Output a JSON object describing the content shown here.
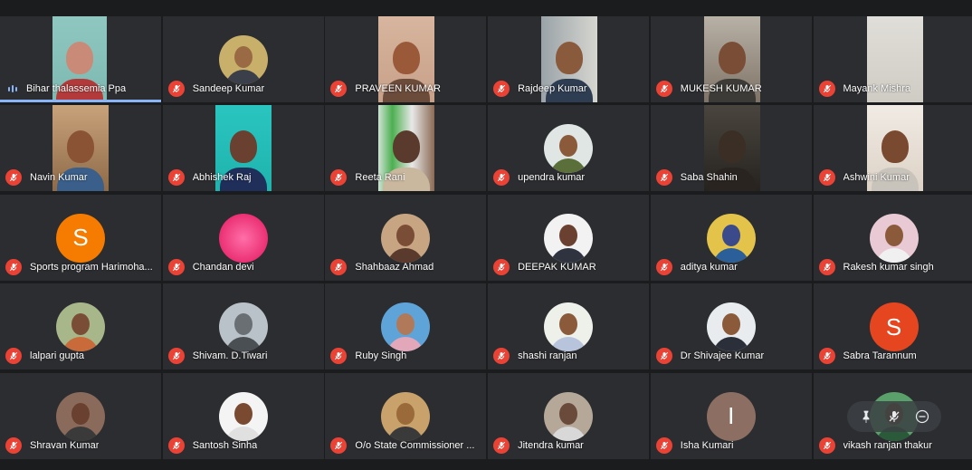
{
  "meeting": {
    "participants": [
      {
        "name": "Bihar thalassemia Ppa",
        "kind": "video",
        "muted": false,
        "speaking": true,
        "photo": "woman-glasses"
      },
      {
        "name": "Sandeep Kumar",
        "kind": "avatar",
        "muted": true,
        "photo": "man-sunglasses"
      },
      {
        "name": "PRAVEEN KUMAR",
        "kind": "video",
        "muted": true,
        "photo": "man-indoor"
      },
      {
        "name": "Rajdeep Kumar",
        "kind": "video",
        "muted": true,
        "photo": "man-window"
      },
      {
        "name": "MUKESH KUMAR",
        "kind": "video",
        "muted": true,
        "photo": "man-roof"
      },
      {
        "name": "Mayank Mishra",
        "kind": "video",
        "muted": true,
        "photo": "wall"
      },
      {
        "name": "Navin Kumar",
        "kind": "video",
        "muted": true,
        "photo": "man-wood"
      },
      {
        "name": "Abhishek Raj",
        "kind": "video",
        "muted": true,
        "photo": "boy-teal"
      },
      {
        "name": "Reeta Rani",
        "kind": "video",
        "muted": true,
        "photo": "flag"
      },
      {
        "name": "upendra kumar",
        "kind": "avatar",
        "muted": true,
        "photo": "man-outdoor"
      },
      {
        "name": "Saba Shahin",
        "kind": "video",
        "muted": true,
        "photo": "dark"
      },
      {
        "name": "Ashwini Kumar",
        "kind": "video",
        "muted": true,
        "photo": "man-bright"
      },
      {
        "name": "Sports program Harimoha...",
        "kind": "letter",
        "letter": "S",
        "color": "#f57c00",
        "muted": true
      },
      {
        "name": "Chandan devi",
        "kind": "avatar",
        "muted": true,
        "photo": "pink-flower"
      },
      {
        "name": "Shahbaaz Ahmad",
        "kind": "avatar",
        "muted": true,
        "photo": "couple"
      },
      {
        "name": "DEEPAK KUMAR",
        "kind": "avatar",
        "muted": true,
        "photo": "man-white"
      },
      {
        "name": "aditya kumar",
        "kind": "avatar",
        "muted": true,
        "photo": "bike"
      },
      {
        "name": "Rakesh kumar singh",
        "kind": "avatar",
        "muted": true,
        "photo": "man-pink"
      },
      {
        "name": "lalpari gupta",
        "kind": "avatar",
        "muted": true,
        "photo": "group"
      },
      {
        "name": "Shivam. D.Tiwari",
        "kind": "avatar",
        "muted": true,
        "photo": "monument"
      },
      {
        "name": "Ruby Singh",
        "kind": "avatar",
        "muted": true,
        "photo": "woman-blue"
      },
      {
        "name": "shashi ranjan",
        "kind": "avatar",
        "muted": true,
        "photo": "man-light"
      },
      {
        "name": "Dr Shivajee Kumar",
        "kind": "avatar",
        "muted": true,
        "photo": "man-suit"
      },
      {
        "name": "Sabra Tarannum",
        "kind": "letter",
        "letter": "S",
        "color": "#e6461f",
        "muted": true
      },
      {
        "name": "Shravan Kumar",
        "kind": "avatar",
        "muted": true,
        "photo": "man-wall"
      },
      {
        "name": "Santosh Sinha",
        "kind": "avatar",
        "muted": true,
        "photo": "man-formal"
      },
      {
        "name": "O/o State Commissioner ...",
        "kind": "avatar",
        "muted": true,
        "photo": "man-smile"
      },
      {
        "name": "Jitendra kumar",
        "kind": "avatar",
        "muted": true,
        "photo": "man-standing"
      },
      {
        "name": "Isha Kumari",
        "kind": "letter",
        "letter": "I",
        "color": "#8d6e63",
        "muted": true
      },
      {
        "name": "vikash ranjan thakur",
        "kind": "avatar",
        "muted": true,
        "photo": "man-green"
      }
    ]
  },
  "pip_controls": {
    "icons": [
      "pin-icon",
      "mute-icon",
      "remove-icon"
    ]
  },
  "colors": {
    "background": "#1b1c1e",
    "tile": "#2c2d30",
    "muted_red": "#ea4335",
    "accent_blue": "#8ab4f8"
  }
}
